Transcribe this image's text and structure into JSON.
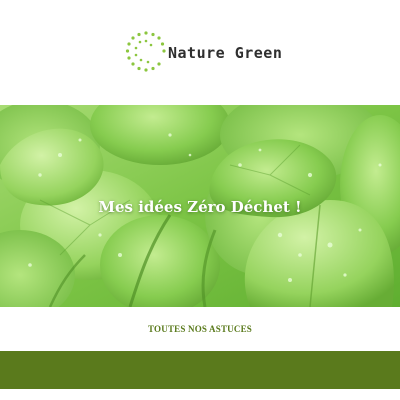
{
  "brand": {
    "name": "Nature Green",
    "accent": "#8cc63f",
    "dark_green": "#5a7a1c"
  },
  "logo": {
    "icon": "leaf-dots-logo-icon"
  },
  "hero": {
    "title": "Mes idées Zéro Déchet !",
    "image": "green-leaves-with-water-drops"
  },
  "links": {
    "all_tips": "TOUTES NOS ASTUCES"
  }
}
